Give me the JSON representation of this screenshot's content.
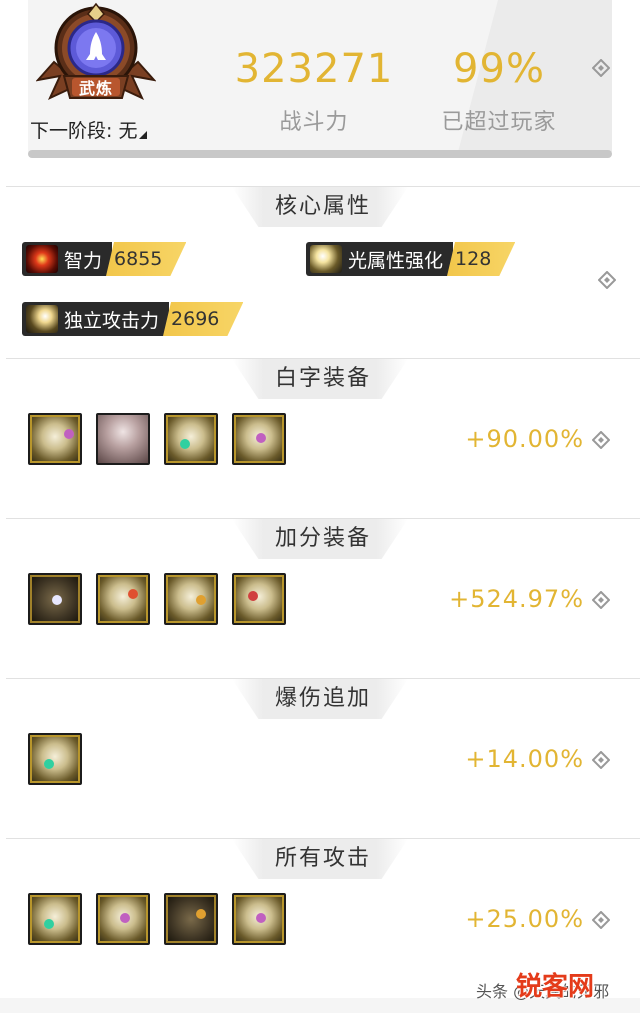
{
  "header": {
    "badge_label": "武炼",
    "next_stage": "下一阶段: 无",
    "power_value": "323271",
    "power_label": "战斗力",
    "percent_value": "99%",
    "percent_label": "已超过玩家"
  },
  "core": {
    "title": "核心属性",
    "attributes": [
      {
        "name": "智力",
        "value": "6855",
        "icon": "eye-icon"
      },
      {
        "name": "光属性强化",
        "value": "128",
        "icon": "light-burst-icon"
      },
      {
        "name": "独立攻击力",
        "value": "2696",
        "icon": "sword-sparkle-icon"
      }
    ]
  },
  "sections": [
    {
      "title": "白字装备",
      "percent": "+90.00%"
    },
    {
      "title": "加分装备",
      "percent": "+524.97%"
    },
    {
      "title": "爆伤追加",
      "percent": "+14.00%"
    },
    {
      "title": "所有攻击",
      "percent": "+25.00%"
    }
  ],
  "watermark": {
    "text": "头条 @天翼的无邪",
    "logo": "锐客网"
  },
  "colors": {
    "accent_gold": "#e2b533",
    "tag_dark": "#2a2a2a",
    "tag_gold": "#f2c64a"
  }
}
